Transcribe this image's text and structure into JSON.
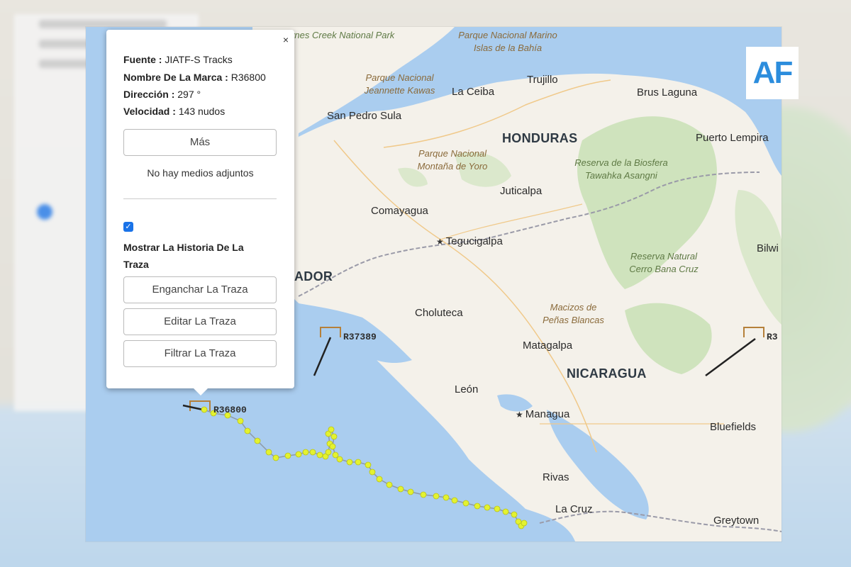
{
  "popup": {
    "close_label": "×",
    "fields": [
      {
        "label": "Fuente :",
        "value": "JIATF-S Tracks"
      },
      {
        "label": "Nombre De La Marca :",
        "value": "R36800"
      },
      {
        "label": "Dirección :",
        "value": "297 °"
      },
      {
        "label": "Velocidad :",
        "value": "143 nudos"
      }
    ],
    "more_button": "Más",
    "no_media": "No hay medios adjuntos",
    "show_history_checked": true,
    "show_history_label": "Mostrar La Historia De La Traza",
    "buttons": [
      "Enganchar La Traza",
      "Editar La Traza",
      "Filtrar La Traza"
    ]
  },
  "map": {
    "countries": [
      "HONDURAS",
      "NICARAGUA"
    ],
    "partial_labels": [
      "ADOR",
      "Bilwi",
      "R3"
    ],
    "cities": [
      "San Pedro Sula",
      "La Ceiba",
      "Trujillo",
      "Brus Laguna",
      "Puerto Lempira",
      "Juticalpa",
      "Comayagua",
      "Tegucigalpa",
      "Choluteca",
      "Matagalpa",
      "León",
      "Managua",
      "Bluefields",
      "Rivas",
      "La Cruz",
      "Greytown"
    ],
    "capitals": [
      "Tegucigalpa",
      "Managua"
    ],
    "parks": [
      "Paynes Creek National Park",
      "Parque Nacional Marino Islas de la Bahía",
      "Parque Nacional Jeannette Kawas",
      "Parque Nacional Montaña de Yoro",
      "Reserva de la Biosfera Tawahka Asangni",
      "Reserva Natural Cerro Bana Cruz",
      "Macizos de Peñas Blancas"
    ],
    "track_labels": [
      "R37389",
      "R36800"
    ]
  },
  "logo": "AF",
  "colors": {
    "water": "#aacdef",
    "land": "#f4f1ea",
    "forest": "#cfe3bd",
    "track_dot": "#e3f230",
    "marker": "#b5803a"
  }
}
